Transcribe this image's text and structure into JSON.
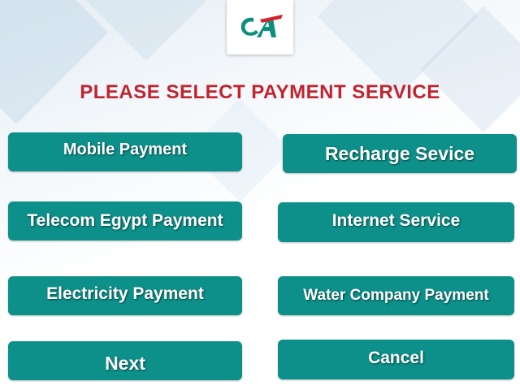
{
  "header": {
    "logo_icon": "credit-agricole-logo",
    "title": "PLEASE SELECT PAYMENT SERVICE",
    "title_color": "#c0242f"
  },
  "buttons": {
    "mobile_payment": "Mobile Payment",
    "recharge_service": "Recharge Sevice",
    "telecom_egypt_payment": "Telecom Egypt Payment",
    "internet_service": "Internet Service",
    "electricity_payment": "Electricity Payment",
    "water_company_payment": "Water Company Payment",
    "next": "Next",
    "cancel": "Cancel"
  },
  "colors": {
    "button_bg": "#0d9089",
    "logo_green": "#0d8f7c",
    "logo_red": "#d2232a"
  }
}
